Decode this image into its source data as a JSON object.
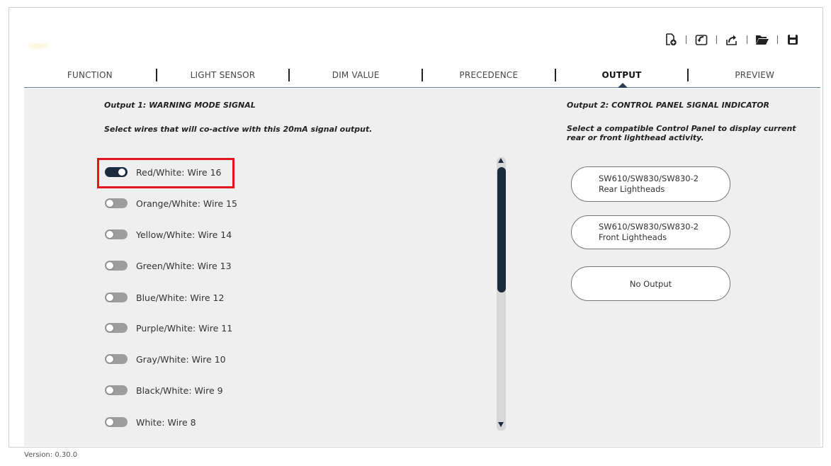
{
  "toolbar": {
    "icons": [
      "new-file-icon",
      "import-icon",
      "export-icon",
      "open-folder-icon",
      "save-icon"
    ]
  },
  "tabs": [
    {
      "label": "FUNCTION",
      "active": false
    },
    {
      "label": "LIGHT SENSOR",
      "active": false
    },
    {
      "label": "DIM VALUE",
      "active": false
    },
    {
      "label": "PRECEDENCE",
      "active": false
    },
    {
      "label": "OUTPUT",
      "active": true
    },
    {
      "label": "PREVIEW",
      "active": false
    }
  ],
  "output1": {
    "title": "Output 1: WARNING MODE SIGNAL",
    "subtitle": "Select wires that will co-active with this 20mA signal output.",
    "wires": [
      {
        "label": "Red/White:  Wire 16",
        "on": true
      },
      {
        "label": "Orange/White:  Wire 15",
        "on": false
      },
      {
        "label": "Yellow/White:  Wire 14",
        "on": false
      },
      {
        "label": "Green/White:  Wire 13",
        "on": false
      },
      {
        "label": "Blue/White:  Wire 12",
        "on": false
      },
      {
        "label": "Purple/White:  Wire 11",
        "on": false
      },
      {
        "label": "Gray/White:  Wire 10",
        "on": false
      },
      {
        "label": "Black/White:  Wire 9",
        "on": false
      },
      {
        "label": "White:  Wire 8",
        "on": false
      }
    ]
  },
  "output2": {
    "title": "Output 2: CONTROL PANEL SIGNAL INDICATOR",
    "subtitle": "Select a compatible Control Panel to display current rear or front lighthead activity.",
    "options": [
      {
        "line1": "SW610/SW830/SW830-2",
        "line2": "Rear Lightheads"
      },
      {
        "line1": "SW610/SW830/SW830-2",
        "line2": "Front Lightheads"
      },
      {
        "line1": "No Output",
        "line2": ""
      }
    ]
  },
  "version": "Version: 0.30.0",
  "colors": {
    "accent": "#1b2b3f",
    "highlight": "#e0161c",
    "panel_bg": "#efefef"
  }
}
